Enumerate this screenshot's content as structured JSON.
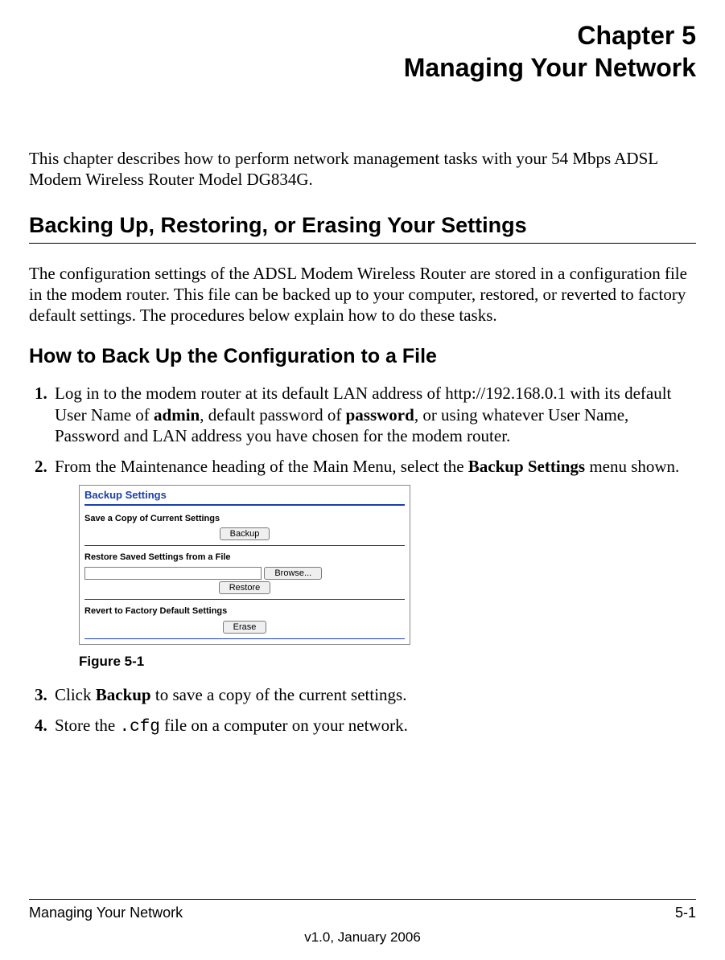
{
  "chapter": {
    "number": "Chapter 5",
    "title": "Managing Your Network"
  },
  "intro": "This chapter describes how to perform network management tasks with your 54 Mbps ADSL Modem Wireless Router Model DG834G.",
  "section1": {
    "heading": "Backing Up, Restoring, or Erasing Your Settings",
    "body": "The configuration settings of the ADSL Modem Wireless Router are stored in a configuration file in the modem router. This file can be backed up to your computer, restored, or reverted to factory default settings. The procedures below explain how to do these tasks."
  },
  "subsection1": {
    "heading": "How to Back Up the Configuration to a File"
  },
  "steps": {
    "s1a": "Log in to the modem router at its default LAN address of http://192.168.0.1 with its default User Name of ",
    "s1_admin": "admin",
    "s1b": ", default password of ",
    "s1_password": "password",
    "s1c": ", or using whatever User Name, Password and LAN address you have chosen for the modem router.",
    "s2a": "From the Maintenance heading of the Main Menu, select the ",
    "s2_bold": "Backup Settings",
    "s2b": " menu shown.",
    "s3a": "Click ",
    "s3_bold": "Backup",
    "s3b": " to save a copy of the current settings.",
    "s4a": "Store the ",
    "s4_code": ".cfg",
    "s4b": " file on a computer on your network."
  },
  "figure": {
    "panel_title": "Backup Settings",
    "save_label": "Save a Copy of Current Settings",
    "backup_btn": "Backup",
    "restore_label": "Restore Saved Settings from a File",
    "browse_btn": "Browse...",
    "restore_btn": "Restore",
    "revert_label": "Revert to Factory Default Settings",
    "erase_btn": "Erase",
    "caption": "Figure 5-1",
    "file_value": ""
  },
  "footer": {
    "left": "Managing Your Network",
    "right": "5-1",
    "version": "v1.0, January 2006"
  }
}
